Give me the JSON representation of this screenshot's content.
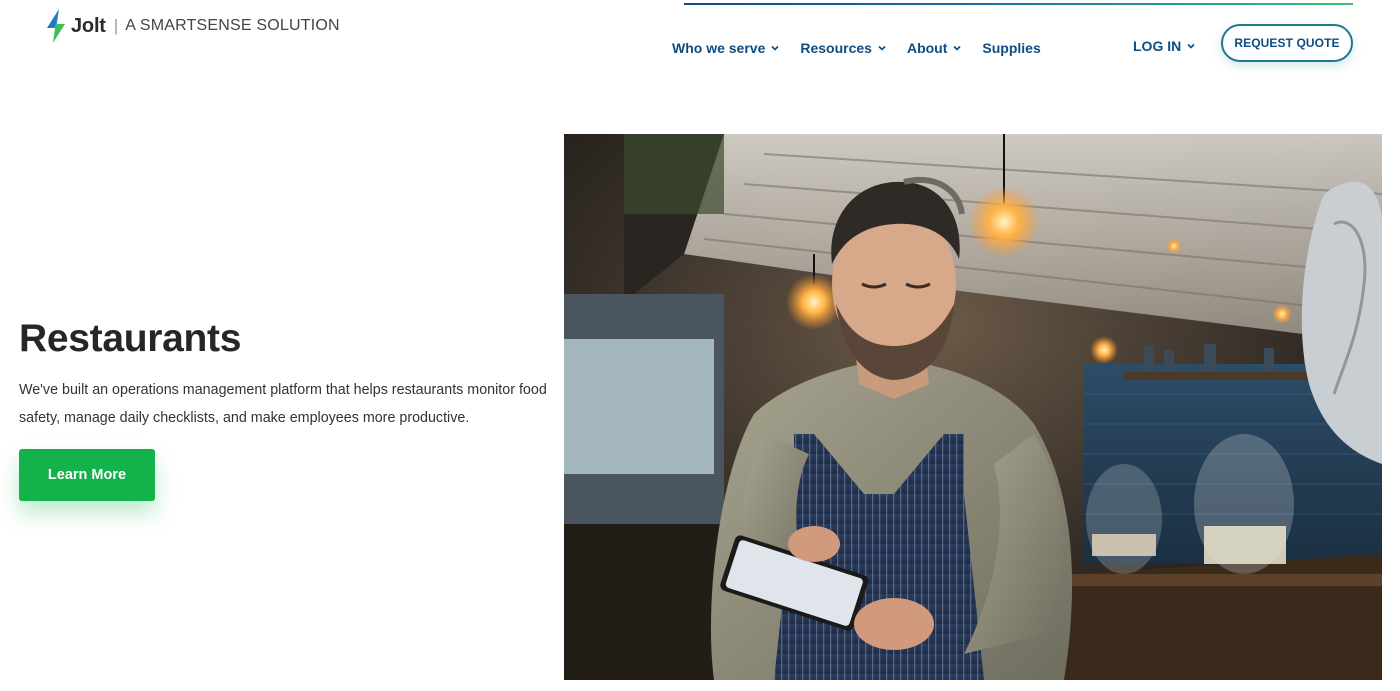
{
  "brand": {
    "logo_name": "Jolt",
    "separator": "|",
    "tagline": "A SMARTSENSE SOLUTION"
  },
  "nav": {
    "items": [
      {
        "label": "Who we serve",
        "has_dropdown": true
      },
      {
        "label": "Resources",
        "has_dropdown": true
      },
      {
        "label": "About",
        "has_dropdown": true
      },
      {
        "label": "Supplies",
        "has_dropdown": false
      }
    ],
    "login_label": "LOG IN",
    "quote_label": "REQUEST QUOTE"
  },
  "hero": {
    "title": "Restaurants",
    "description": "We've built an operations management platform that helps restaurants monitor food safety, manage daily checklists, and make employees more productive.",
    "cta_label": "Learn More"
  },
  "colors": {
    "nav_text": "#0f4c81",
    "cta_green": "#13b24a",
    "quote_border": "#1b7a8c",
    "logo_blue": "#1f7bc1",
    "logo_green": "#3fbf57"
  },
  "icons": {
    "logo": "jolt-bolt-icon",
    "dropdown": "chevron-down-icon"
  }
}
